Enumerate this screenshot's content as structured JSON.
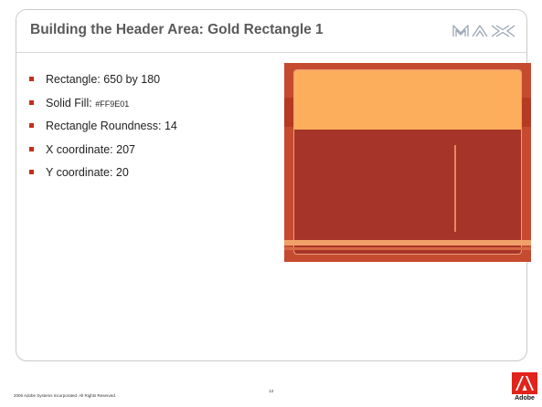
{
  "slide": {
    "title": "Building the Header Area: Gold Rectangle 1",
    "logo_text": "MAX",
    "bullets": [
      {
        "text": "Rectangle: 650 by 180"
      },
      {
        "text": "Solid Fill: ",
        "code": "#FF9E01"
      },
      {
        "text": "Rectangle Roundness: 14"
      },
      {
        "text": "X coordinate: 207"
      },
      {
        "text": "Y coordinate: 20"
      }
    ],
    "preview_image": {
      "colors": {
        "background": "#c54b30",
        "gold_rectangle": "#fdae5c",
        "body": "#a73428"
      }
    }
  },
  "footer": {
    "copyright": "2006 Adobe Systems Incorporated.  All Rights Reserved.",
    "page_number": "13",
    "brand": "Adobe"
  },
  "colors": {
    "title": "#5a5a5a",
    "bullet_marker": "#c0301c",
    "frame_border": "#c9c9c9",
    "adobe_red": "#e2231a"
  },
  "icons": {
    "logo": "max-logo",
    "brand": "adobe-logo-icon"
  }
}
